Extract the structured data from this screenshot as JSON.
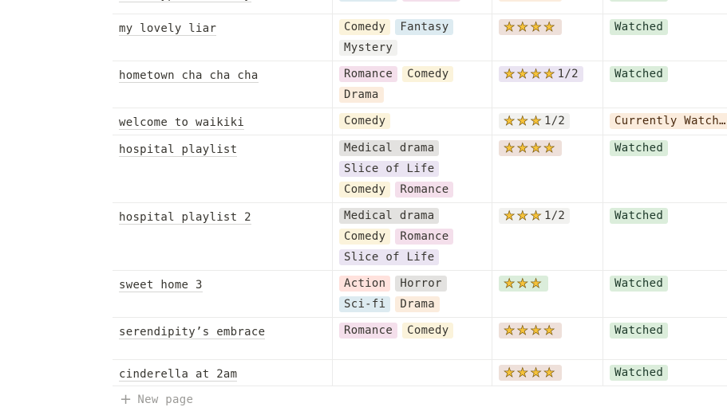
{
  "rows": [
    {
      "title": "the atypical family",
      "genres": [
        {
          "label": "Fantasy",
          "color": "#ddebf1"
        },
        {
          "label": "Romance",
          "color": "#f4dfeb"
        }
      ],
      "rating": {
        "stars": 4,
        "half_label": "",
        "bg": "#fbecdd"
      },
      "status": {
        "label": "Watched",
        "color": "#dbeddb"
      }
    },
    {
      "title": "my lovely liar",
      "genres": [
        {
          "label": "Comedy",
          "color": "#fbf3db"
        },
        {
          "label": "Fantasy",
          "color": "#ddebf1"
        },
        {
          "label": "Mystery",
          "color": "#f1f1ef"
        }
      ],
      "rating": {
        "stars": 4,
        "half_label": "",
        "bg": "#eee0da"
      },
      "status": {
        "label": "Watched",
        "color": "#dbeddb"
      }
    },
    {
      "title": "hometown cha cha cha",
      "genres": [
        {
          "label": "Romance",
          "color": "#f4dfeb"
        },
        {
          "label": "Comedy",
          "color": "#fbf3db"
        },
        {
          "label": "Drama",
          "color": "#fbecdd"
        }
      ],
      "rating": {
        "stars": 4,
        "half_label": "1/2",
        "bg": "#eae4f2"
      },
      "status": {
        "label": "Watched",
        "color": "#dbeddb"
      }
    },
    {
      "title": "welcome to waikiki",
      "genres": [
        {
          "label": "Comedy",
          "color": "#fbf3db"
        }
      ],
      "rating": {
        "stars": 3,
        "half_label": "1/2",
        "bg": "#f1f1ef"
      },
      "status": {
        "label": "Currently Watching",
        "color": "#fbecdd"
      }
    },
    {
      "title": "hospital playlist",
      "genres": [
        {
          "label": "Medical drama",
          "color": "#e3e2e0"
        },
        {
          "label": "Slice of Life",
          "color": "#eae4f2"
        },
        {
          "label": "Comedy",
          "color": "#fbf3db"
        },
        {
          "label": "Romance",
          "color": "#f4dfeb"
        }
      ],
      "rating": {
        "stars": 4,
        "half_label": "",
        "bg": "#eee0da"
      },
      "status": {
        "label": "Watched",
        "color": "#dbeddb"
      }
    },
    {
      "title": "hospital playlist 2",
      "genres": [
        {
          "label": "Medical drama",
          "color": "#e3e2e0"
        },
        {
          "label": "Comedy",
          "color": "#fbf3db"
        },
        {
          "label": "Romance",
          "color": "#f4dfeb"
        },
        {
          "label": "Slice of Life",
          "color": "#eae4f2"
        }
      ],
      "rating": {
        "stars": 3,
        "half_label": "1/2",
        "bg": "#f1f1ef"
      },
      "status": {
        "label": "Watched",
        "color": "#dbeddb"
      }
    },
    {
      "title": "sweet home 3",
      "genres": [
        {
          "label": "Action",
          "color": "#ffe2dd"
        },
        {
          "label": "Horror",
          "color": "#e3e2e0"
        },
        {
          "label": "Sci-fi",
          "color": "#ddebf1"
        },
        {
          "label": "Drama",
          "color": "#fbecdd"
        }
      ],
      "rating": {
        "stars": 3,
        "half_label": "",
        "bg": "#dbeddb"
      },
      "status": {
        "label": "Watched",
        "color": "#dbeddb"
      }
    },
    {
      "title": "serendipity’s embrace",
      "genres": [
        {
          "label": "Romance",
          "color": "#f4dfeb"
        },
        {
          "label": "Comedy",
          "color": "#fbf3db"
        }
      ],
      "rating": {
        "stars": 4,
        "half_label": "",
        "bg": "#eee0da"
      },
      "status": {
        "label": "Watched",
        "color": "#dbeddb"
      }
    },
    {
      "title": "cinderella at 2am",
      "genres": [],
      "rating": {
        "stars": 4,
        "half_label": "",
        "bg": "#eee0da"
      },
      "status": {
        "label": "Watched",
        "color": "#dbeddb"
      }
    }
  ],
  "new_page": {
    "icon": "plus-icon",
    "label": "New page"
  }
}
